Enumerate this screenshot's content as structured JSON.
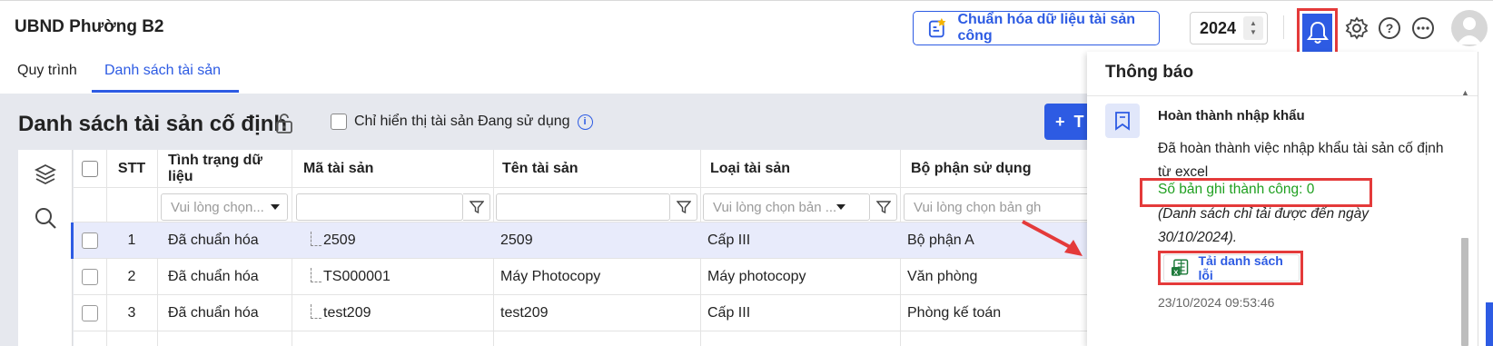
{
  "header": {
    "app_title": "UBND Phường B2",
    "standardize_button": "Chuẩn hóa dữ liệu tài sản công",
    "year": "2024"
  },
  "tabs": [
    {
      "label": "Quy trình"
    },
    {
      "label": "Danh sách tài sản"
    }
  ],
  "list": {
    "title": "Danh sách tài sản cố định",
    "only_in_use_label": "Chỉ hiển thị tài sản Đang sử dụng",
    "add_button": "T"
  },
  "table": {
    "columns": [
      "STT",
      "Tình trạng dữ liệu",
      "Mã tài sản",
      "Tên tài sản",
      "Loại tài sản",
      "Bộ phận sử dụng"
    ],
    "filters": {
      "status_placeholder": "Vui lòng chọn...",
      "type_placeholder": "Vui lòng chọn bản ...",
      "dept_placeholder": "Vui lòng chọn bản gh"
    },
    "rows": [
      {
        "stt": "1",
        "status": "Đã chuẩn hóa",
        "code": "2509",
        "name": "2509",
        "type": "Cấp III",
        "dept": "Bộ phận A"
      },
      {
        "stt": "2",
        "status": "Đã chuẩn hóa",
        "code": "TS000001",
        "name": "Máy Photocopy",
        "type": "Máy photocopy",
        "dept": "Văn phòng"
      },
      {
        "stt": "3",
        "status": "Đã chuẩn hóa",
        "code": "test209",
        "name": "test209",
        "type": "Cấp III",
        "dept": "Phòng kế toán"
      }
    ]
  },
  "notifications": {
    "title": "Thông báo",
    "item": {
      "heading": "Hoàn thành nhập khẩu",
      "body": "Đã hoàn thành việc nhập khẩu tài sản cố định từ excel",
      "success": "Số bản ghi thành công: 0",
      "note": "(Danh sách chỉ tải được đến ngày 30/10/2024).",
      "download_label": "Tải danh sách lỗi",
      "timestamp": "23/10/2024 09:53:46"
    }
  },
  "colors": {
    "accent": "#2d5be3",
    "highlight": "#e43a3a",
    "success": "#1fa020"
  }
}
